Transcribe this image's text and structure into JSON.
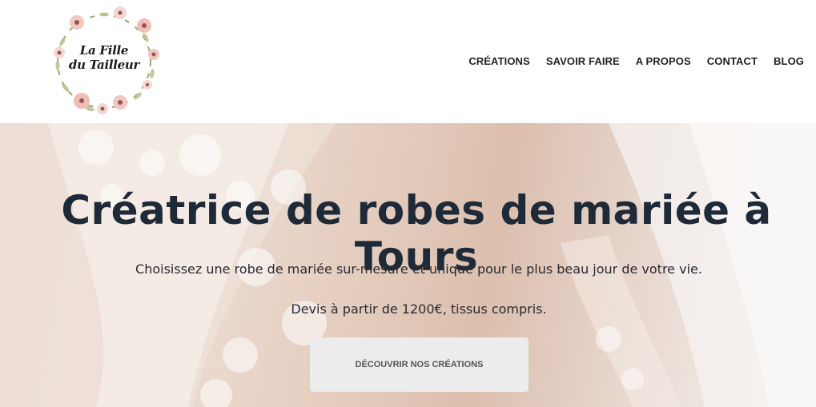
{
  "logo": {
    "line1": "La Fille",
    "line2": "du Tailleur",
    "wreath_icon": "floral-wreath"
  },
  "nav": {
    "items": [
      {
        "label": "CRÉATIONS"
      },
      {
        "label": "SAVOIR FAIRE"
      },
      {
        "label": "A PROPOS"
      },
      {
        "label": "CONTACT"
      },
      {
        "label": "BLOG"
      }
    ]
  },
  "hero": {
    "title": "Créatrice de robes de mariée à Tours",
    "subtitle": "Choisissez une robe de mariée sur-mesure et unique pour le plus beau jour de votre vie.",
    "price_note": "Devis à partir de 1200€, tissus compris.",
    "cta_label": "DÉCOUVRIR NOS CRÉATIONS",
    "background": "wedding-dress-lace-photo"
  },
  "colors": {
    "title": "#1f2a38",
    "nav_text": "#222222",
    "button_bg": "#ececec",
    "button_text": "#555555",
    "flower_pink": "#f4c6c2"
  }
}
